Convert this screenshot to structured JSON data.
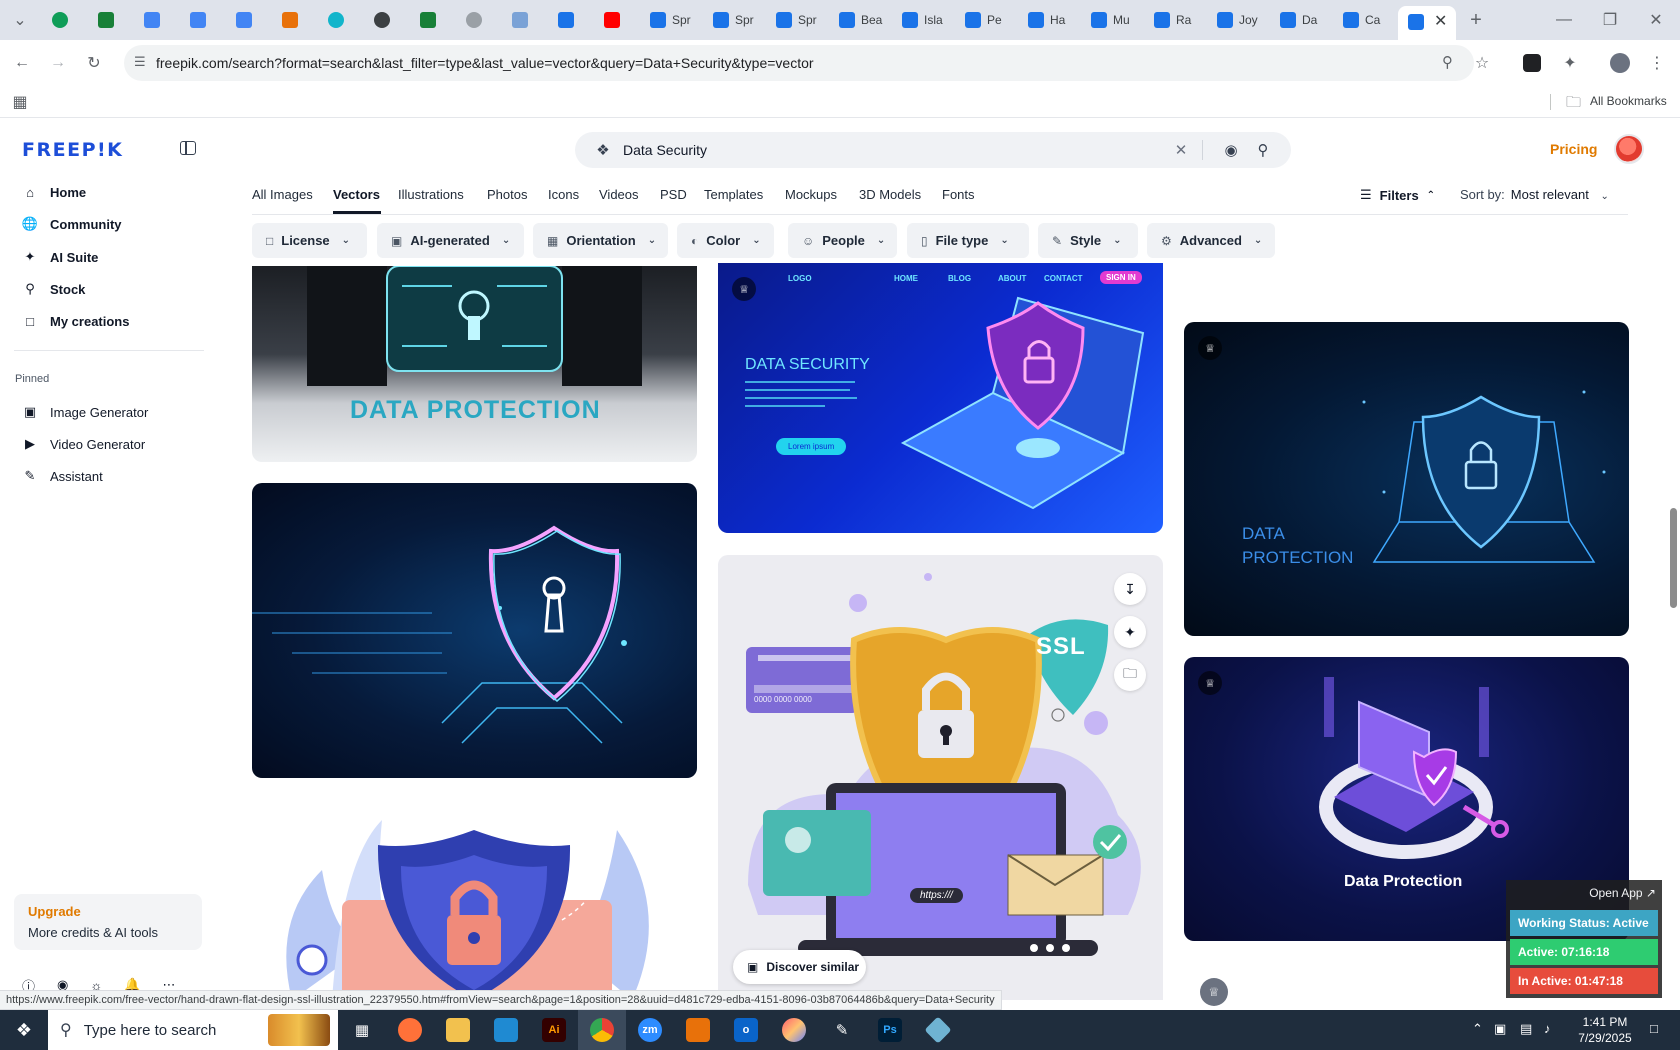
{
  "browser": {
    "tabs": [
      "Spr",
      "Spr",
      "Spr",
      "Bea",
      "Isla",
      "Pe",
      "Ha",
      "Mu",
      "Ra",
      "Joy",
      "Da",
      "Ca"
    ],
    "url": "freepik.com/search?format=search&last_filter=type&last_value=vector&query=Data+Security&type=vector",
    "all_bookmarks": "All Bookmarks",
    "status_url": "https://www.freepik.com/free-vector/hand-drawn-flat-design-ssl-illustration_22379550.htm#fromView=search&page=1&position=28&uuid=d481c729-edba-4151-8096-03b87064486b&query=Data+Security"
  },
  "sidebar": {
    "logo": "FREEP!K",
    "items": [
      {
        "label": "Home",
        "icon": "home-icon"
      },
      {
        "label": "Community",
        "icon": "globe-icon"
      },
      {
        "label": "AI Suite",
        "icon": "sparkle-icon"
      },
      {
        "label": "Stock",
        "icon": "search-icon"
      },
      {
        "label": "My creations",
        "icon": "folder-icon"
      }
    ],
    "pinned_label": "Pinned",
    "pinned": [
      {
        "label": "Image Generator",
        "icon": "image-icon"
      },
      {
        "label": "Video Generator",
        "icon": "video-icon"
      },
      {
        "label": "Assistant",
        "icon": "chat-icon"
      }
    ],
    "upgrade": {
      "title": "Upgrade",
      "subtitle": "More credits & AI tools"
    }
  },
  "search": {
    "value": "Data Security"
  },
  "header": {
    "pricing": "Pricing"
  },
  "type_tabs": [
    "All Images",
    "Vectors",
    "Illustrations",
    "Photos",
    "Icons",
    "Videos",
    "PSD",
    "Templates",
    "Mockups",
    "3D Models",
    "Fonts"
  ],
  "active_tab": "Vectors",
  "filters": {
    "label": "Filters",
    "sort_label": "Sort by:",
    "sort_value": "Most relevant"
  },
  "chips": [
    "License",
    "AI-generated",
    "Orientation",
    "Color",
    "People",
    "File type",
    "Style",
    "Advanced"
  ],
  "image_text": {
    "card1": "DATA PROTECTION",
    "card3_nav": [
      "LOGO",
      "HOME",
      "BLOG",
      "ABOUT",
      "CONTACT",
      "SIGN IN"
    ],
    "card3_title": "DATA SECURITY",
    "card3_btn": "Lorem ipsum",
    "card4_ssl": "SSL",
    "card4_card_number": "0000 0000 0000",
    "card4_https": "https:///",
    "card5_title": "DATA\nPROTECTION",
    "card6_title": "Data Protection"
  },
  "discover_similar": "Discover similar",
  "widget": {
    "open_app": "Open App ↗",
    "status": "Working Status: Active",
    "active": "Active: 07:16:18",
    "inactive": "In Active: 01:47:18"
  },
  "taskbar": {
    "search_placeholder": "Type here to search",
    "time": "1:41 PM",
    "date": "7/29/2025"
  },
  "colors": {
    "accent": "#1d4ed8",
    "pricing": "#e07a00",
    "widget_status": "#3da5c4",
    "widget_active": "#2ecc71",
    "widget_inactive": "#e74c3c"
  }
}
